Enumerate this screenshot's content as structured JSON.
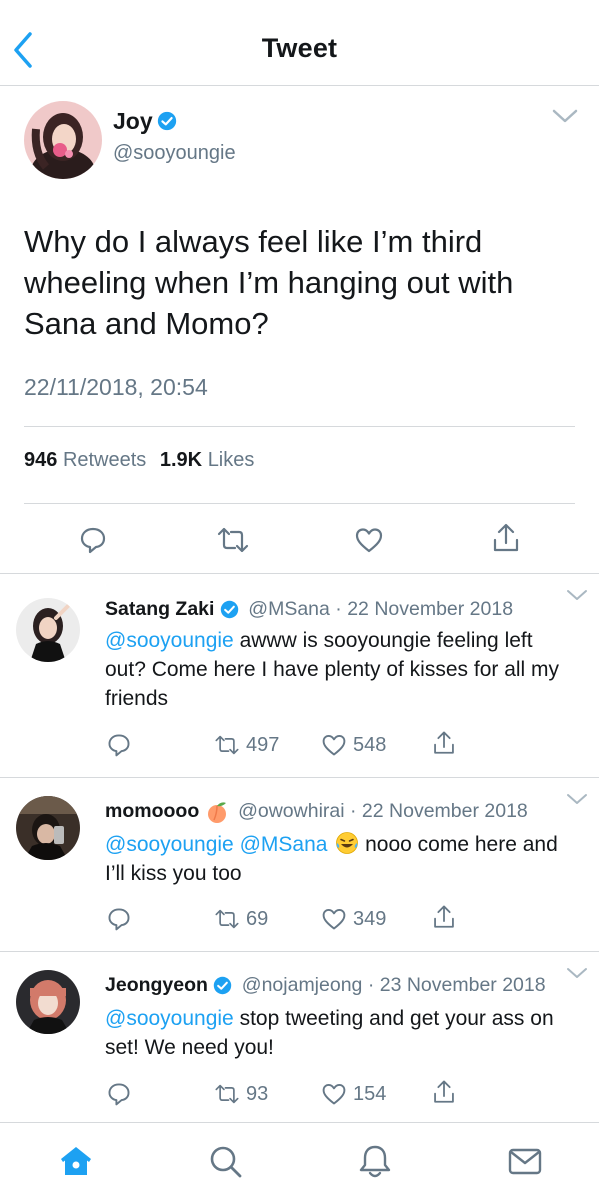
{
  "header": {
    "title": "Tweet",
    "back_icon": "chevron-left-icon"
  },
  "main_tweet": {
    "author_name": "Joy",
    "author_handle": "@sooyoungie",
    "text": "Why do I always feel like I’m third wheeling when I’m hanging out with Sana and Momo?",
    "timestamp": "22/11/2018, 20:54",
    "retweets_count": "946",
    "retweets_label": "Retweets",
    "likes_count": "1.9K",
    "likes_label": "Likes"
  },
  "replies": [
    {
      "name": "Satang Zaki",
      "verified": true,
      "meta": "@MSana · 22 November 2018",
      "mentions": "@sooyoungie",
      "text": " awww is sooyoungie feeling left out? Come here I have plenty of kisses for all my friends",
      "retweets": "497",
      "likes": "548"
    },
    {
      "name": "momoooo",
      "emoji_badge": "peach-icon",
      "meta": "@owowhirai · 22 November 2018",
      "mentions": "@sooyoungie @MSana",
      "text": " nooo come here and I’ll kiss you too",
      "emoji": "laughing-tears-icon",
      "retweets": "69",
      "likes": "349"
    },
    {
      "name": "Jeongyeon",
      "verified": true,
      "meta": "@nojamjeong · 23 November 2018",
      "mentions": "@sooyoungie",
      "text": " stop tweeting and get your ass on set! We need you!",
      "retweets": "93",
      "likes": "154"
    }
  ],
  "tabbar": {
    "items": [
      "home-icon",
      "search-icon",
      "notifications-icon",
      "messages-icon"
    ]
  },
  "colors": {
    "accent": "#1da1f2",
    "secondary_text": "#657786",
    "divider": "#d6d9dc"
  }
}
